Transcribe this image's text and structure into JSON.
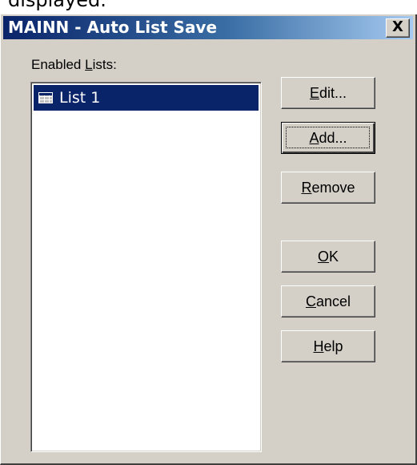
{
  "top_caption": "displayed.",
  "window": {
    "title": "MAINN - Auto List Save",
    "close_glyph": "X"
  },
  "enabled_lists": {
    "label_prefix": "Enabled ",
    "label_mnemonic": "L",
    "label_suffix": "ists:",
    "items": [
      {
        "label": "List 1",
        "icon": "table-icon",
        "selected": true
      }
    ]
  },
  "buttons": {
    "edit": {
      "mnemonic": "E",
      "rest": "dit..."
    },
    "add": {
      "mnemonic": "A",
      "rest": "dd..."
    },
    "remove": {
      "mnemonic": "R",
      "rest": "emove"
    },
    "ok": {
      "mnemonic": "O",
      "rest": "K"
    },
    "cancel": {
      "mnemonic": "C",
      "rest": "ancel"
    },
    "help": {
      "mnemonic": "H",
      "rest": "elp"
    }
  },
  "colors": {
    "title_active": "#0a246a",
    "dialog_face": "#d4d0c8",
    "selection": "#0a246a"
  }
}
